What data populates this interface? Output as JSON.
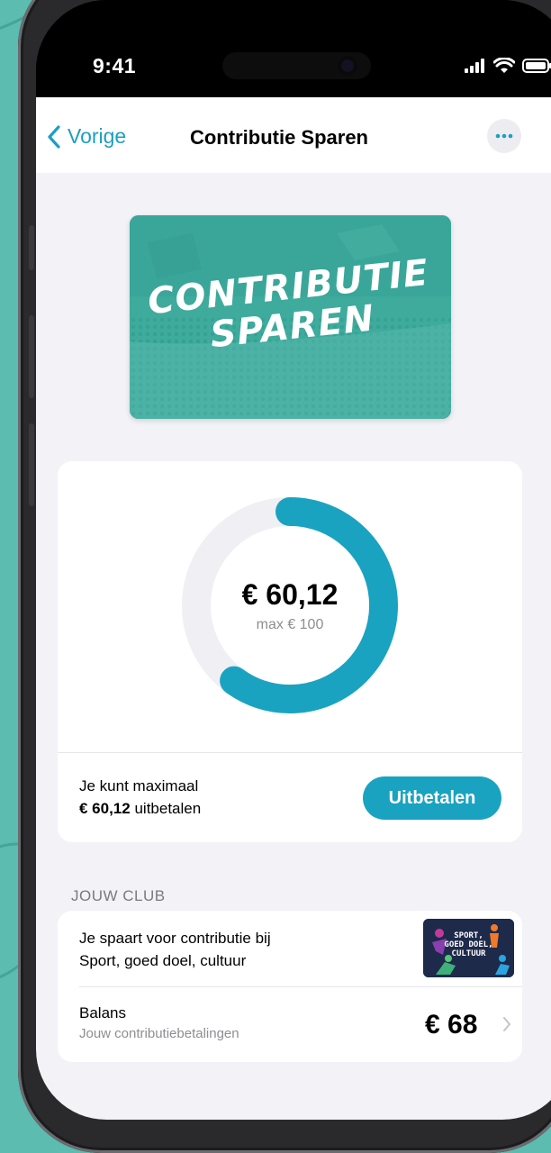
{
  "status_bar": {
    "time": "9:41"
  },
  "nav": {
    "back_label": "Vorige",
    "title": "Contributie Sparen"
  },
  "banner": {
    "line1": "CONTRIBUTIE",
    "line2": "SPAREN"
  },
  "savings": {
    "amount": "€ 60,12",
    "max_label": "max € 100",
    "progress_fraction": 0.6012,
    "payout_line1": "Je kunt maximaal",
    "payout_amount": "€ 60,12",
    "payout_suffix": " uitbetalen",
    "payout_button": "Uitbetalen"
  },
  "club": {
    "section_header": "JOUW CLUB",
    "line1": "Je spaart voor contributie bij",
    "line2": "Sport, goed doel, cultuur",
    "logo_text_1": "SPORT,",
    "logo_text_2": "GOED DOEL,",
    "logo_text_3": "CULTUUR",
    "balance_label": "Balans",
    "balance_sub": "Jouw contributiebetalingen",
    "balance_amount": "€ 68"
  },
  "colors": {
    "accent": "#1aa3c1",
    "banner": "#3eab9d",
    "background": "#5bbcaf"
  },
  "icons": {
    "back": "chevron-left-icon",
    "more": "ellipsis-icon",
    "row": "chevron-right-icon"
  }
}
